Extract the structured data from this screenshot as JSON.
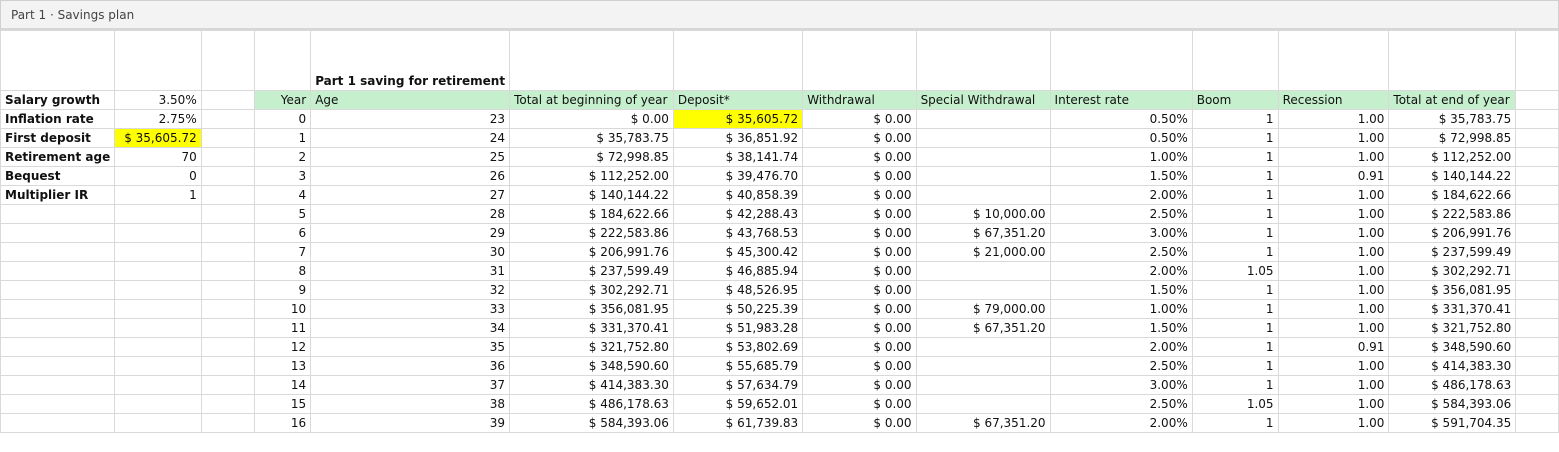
{
  "window": {
    "title": "Part 1 · Savings plan"
  },
  "sheet": {
    "title": "Part 1 saving for retirement",
    "params": [
      {
        "label": "Salary growth",
        "value": "3.50%"
      },
      {
        "label": "Inflation rate",
        "value": "2.75%"
      },
      {
        "label": "First deposit",
        "value": "$ 35,605.72"
      },
      {
        "label": "Retirement age",
        "value": "70"
      },
      {
        "label": "Bequest",
        "value": "0"
      },
      {
        "label": "Multiplier IR",
        "value": "1"
      }
    ],
    "headers": [
      "Year",
      "Age",
      "Total at beginning of year",
      "Deposit*",
      "Withdrawal",
      "Special Withdrawal",
      "Interest rate",
      "Boom",
      "Recession",
      "Total at end of year"
    ],
    "rows": [
      [
        "0",
        "23",
        "$ 0.00",
        "$ 35,605.72",
        "$ 0.00",
        "",
        "0.50%",
        "1",
        "1.00",
        "$ 35,783.75"
      ],
      [
        "1",
        "24",
        "$ 35,783.75",
        "$ 36,851.92",
        "$ 0.00",
        "",
        "0.50%",
        "1",
        "1.00",
        "$ 72,998.85"
      ],
      [
        "2",
        "25",
        "$ 72,998.85",
        "$ 38,141.74",
        "$ 0.00",
        "",
        "1.00%",
        "1",
        "1.00",
        "$ 112,252.00"
      ],
      [
        "3",
        "26",
        "$ 112,252.00",
        "$ 39,476.70",
        "$ 0.00",
        "",
        "1.50%",
        "1",
        "0.91",
        "$ 140,144.22"
      ],
      [
        "4",
        "27",
        "$ 140,144.22",
        "$ 40,858.39",
        "$ 0.00",
        "",
        "2.00%",
        "1",
        "1.00",
        "$ 184,622.66"
      ],
      [
        "5",
        "28",
        "$ 184,622.66",
        "$ 42,288.43",
        "$ 0.00",
        "$ 10,000.00",
        "2.50%",
        "1",
        "1.00",
        "$ 222,583.86"
      ],
      [
        "6",
        "29",
        "$ 222,583.86",
        "$ 43,768.53",
        "$ 0.00",
        "$ 67,351.20",
        "3.00%",
        "1",
        "1.00",
        "$ 206,991.76"
      ],
      [
        "7",
        "30",
        "$ 206,991.76",
        "$ 45,300.42",
        "$ 0.00",
        "$ 21,000.00",
        "2.50%",
        "1",
        "1.00",
        "$ 237,599.49"
      ],
      [
        "8",
        "31",
        "$ 237,599.49",
        "$ 46,885.94",
        "$ 0.00",
        "",
        "2.00%",
        "1.05",
        "1.00",
        "$ 302,292.71"
      ],
      [
        "9",
        "32",
        "$ 302,292.71",
        "$ 48,526.95",
        "$ 0.00",
        "",
        "1.50%",
        "1",
        "1.00",
        "$ 356,081.95"
      ],
      [
        "10",
        "33",
        "$ 356,081.95",
        "$ 50,225.39",
        "$ 0.00",
        "$ 79,000.00",
        "1.00%",
        "1",
        "1.00",
        "$ 331,370.41"
      ],
      [
        "11",
        "34",
        "$ 331,370.41",
        "$ 51,983.28",
        "$ 0.00",
        "$ 67,351.20",
        "1.50%",
        "1",
        "1.00",
        "$ 321,752.80"
      ],
      [
        "12",
        "35",
        "$ 321,752.80",
        "$ 53,802.69",
        "$ 0.00",
        "",
        "2.00%",
        "1",
        "0.91",
        "$ 348,590.60"
      ],
      [
        "13",
        "36",
        "$ 348,590.60",
        "$ 55,685.79",
        "$ 0.00",
        "",
        "2.50%",
        "1",
        "1.00",
        "$ 414,383.30"
      ],
      [
        "14",
        "37",
        "$ 414,383.30",
        "$ 57,634.79",
        "$ 0.00",
        "",
        "3.00%",
        "1",
        "1.00",
        "$ 486,178.63"
      ],
      [
        "15",
        "38",
        "$ 486,178.63",
        "$ 59,652.01",
        "$ 0.00",
        "",
        "2.50%",
        "1.05",
        "1.00",
        "$ 584,393.06"
      ],
      [
        "16",
        "39",
        "$ 584,393.06",
        "$ 61,739.83",
        "$ 0.00",
        "$ 67,351.20",
        "2.00%",
        "1",
        "1.00",
        "$ 591,704.35"
      ]
    ],
    "colors": {
      "header_bg": "#c6efce",
      "highlight": "#ffff00",
      "grid": "#d9d9d9"
    }
  }
}
